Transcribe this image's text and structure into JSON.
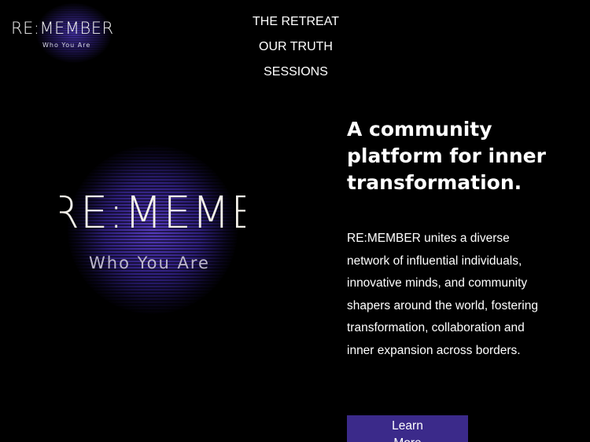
{
  "header": {
    "logo_main": "RE:MEMBER",
    "logo_sub": "Who You Are",
    "nav": [
      "THE RETREAT",
      "OUR TRUTH",
      "SESSIONS"
    ]
  },
  "hero": {
    "graphic_main": "RE:MEMBER",
    "graphic_sub": "Who You Are",
    "headline": "A community platform for inner transformation.",
    "body": "RE:MEMBER unites a diverse network of influential individuals, innovative minds, and community shapers around the world, fostering transformation, collaboration and inner expansion across borders.",
    "cta_label": "Learn More"
  },
  "colors": {
    "background": "#000000",
    "accent": "#3b2a8a",
    "glow": "#5a3ec8"
  }
}
